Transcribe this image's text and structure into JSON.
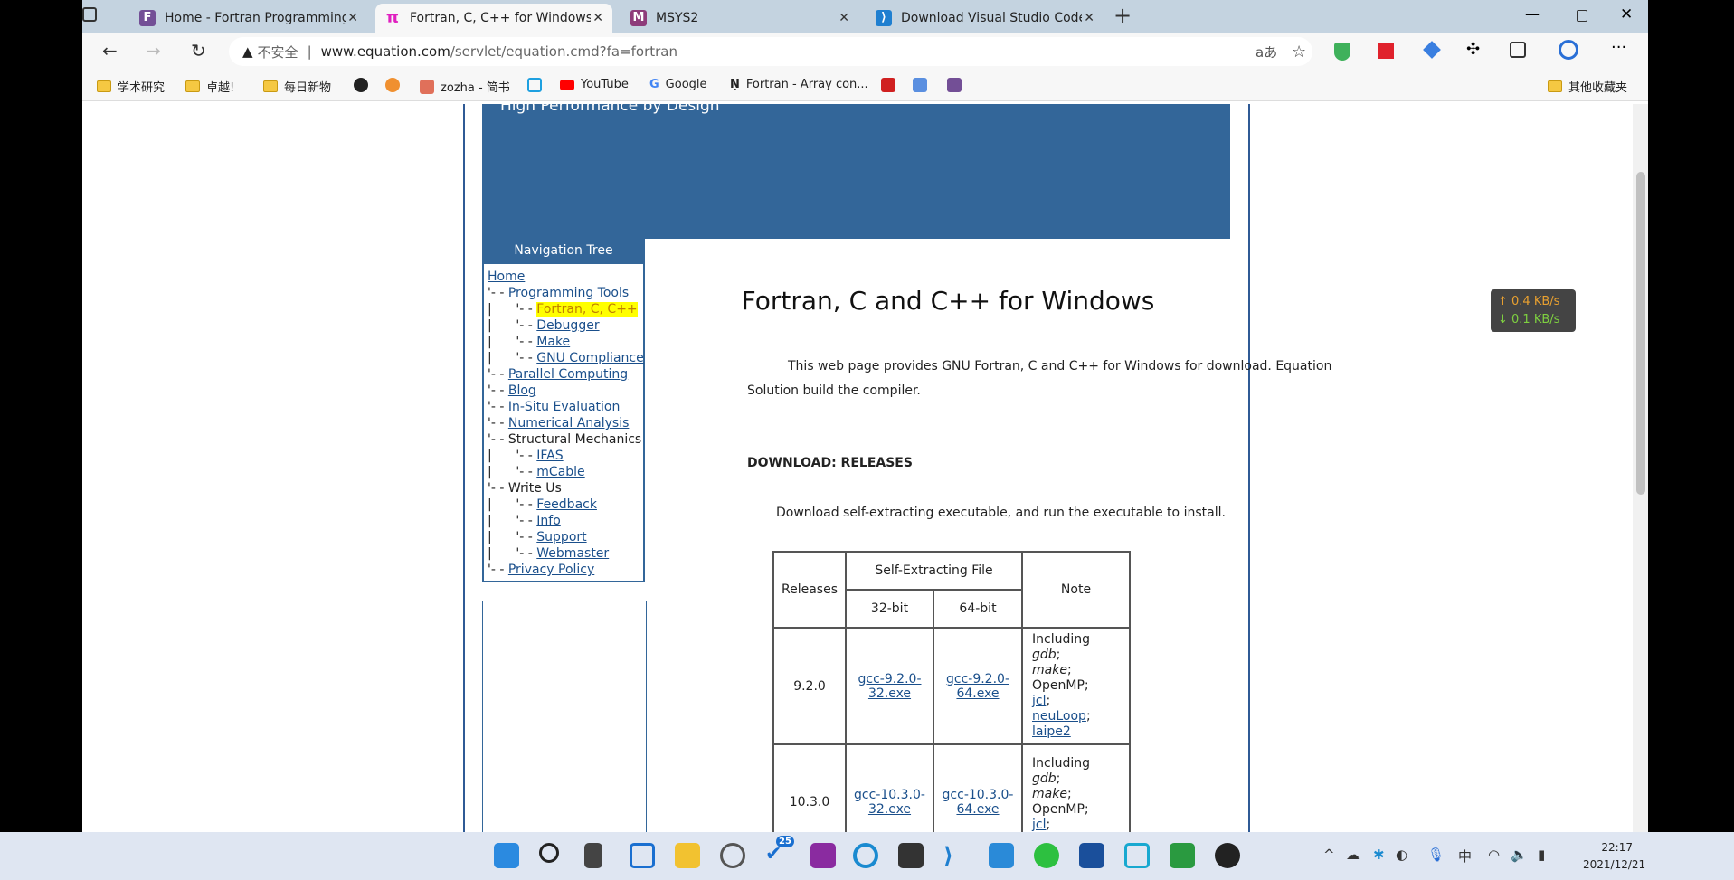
{
  "browser": {
    "tabs": [
      {
        "title": "Home - Fortran Programming La",
        "icon": "fortran-f-icon",
        "color": "#734f96"
      },
      {
        "title": "Fortran, C, C++ for Windows",
        "icon": "pi-icon",
        "color": "#e020c0",
        "active": true
      },
      {
        "title": "MSYS2",
        "icon": "msys2-icon",
        "color": "#8e3b7a"
      },
      {
        "title": "Download Visual Studio Code - M",
        "icon": "vscode-icon",
        "color": "#1f7fd0"
      }
    ],
    "security_label": "不安全",
    "url_host": "www.equation.com",
    "url_path": "/servlet/equation.cmd?fa=fortran",
    "bookmarks": [
      "学术研究",
      "卓越!",
      "每日新物",
      "zozha - 简书",
      "YouTube",
      "Google",
      "Fortran - Array con..."
    ],
    "other_bookmarks": "其他收藏夹"
  },
  "page": {
    "banner_text": "High Performance by Design",
    "nav_title": "Navigation Tree",
    "nav": [
      {
        "prefix": "",
        "label": "Home",
        "link": true
      },
      {
        "prefix": "'- - ",
        "label": "Programming Tools",
        "link": true
      },
      {
        "prefix": "|      '- - ",
        "label": "Fortran, C, C++",
        "current": true
      },
      {
        "prefix": "|      '- - ",
        "label": "Debugger",
        "link": true
      },
      {
        "prefix": "|      '- - ",
        "label": "Make",
        "link": true
      },
      {
        "prefix": "|      '- - ",
        "label": "GNU Compliance",
        "link": true
      },
      {
        "prefix": "'- - ",
        "label": "Parallel Computing",
        "link": true
      },
      {
        "prefix": "'- - ",
        "label": "Blog",
        "link": true
      },
      {
        "prefix": "'- - ",
        "label": "In-Situ Evaluation",
        "link": true
      },
      {
        "prefix": "'- - ",
        "label": "Numerical Analysis",
        "link": true
      },
      {
        "prefix": "'- - ",
        "label": "Structural Mechanics",
        "link": false
      },
      {
        "prefix": "|      '- - ",
        "label": "IFAS",
        "link": true
      },
      {
        "prefix": "|      '- - ",
        "label": "mCable",
        "link": true
      },
      {
        "prefix": "'- - ",
        "label": "Write Us",
        "link": false
      },
      {
        "prefix": "|      '- - ",
        "label": "Feedback",
        "link": true
      },
      {
        "prefix": "|      '- - ",
        "label": "Info",
        "link": true
      },
      {
        "prefix": "|      '- - ",
        "label": "Support",
        "link": true
      },
      {
        "prefix": "|      '- - ",
        "label": "Webmaster",
        "link": true
      },
      {
        "prefix": "'- - ",
        "label": "Privacy Policy",
        "link": true
      }
    ],
    "title": "Fortran, C and C++ for Windows",
    "intro_line1": "This web page provides GNU Fortran, C and C++ for Windows for download. Equation",
    "intro_line2": "Solution build the compiler.",
    "section": "DOWNLOAD: RELEASES",
    "download_text": "Download self-extracting executable, and run the executable to install.",
    "table": {
      "h_releases": "Releases",
      "h_file": "Self-Extracting File",
      "h_note": "Note",
      "h_32": "32-bit",
      "h_64": "64-bit",
      "rows": [
        {
          "release": "9.2.0",
          "f32a": "gcc-9.2.0-",
          "f32b": "32.exe",
          "f64a": "gcc-9.2.0-",
          "f64b": "64.exe"
        },
        {
          "release": "10.3.0",
          "f32a": "gcc-10.3.0-",
          "f32b": "32.exe",
          "f64a": "gcc-10.3.0-",
          "f64b": "64.exe"
        }
      ],
      "note": {
        "including": "Including ",
        "gdb": "gdb",
        "semi": ";",
        "make": "make",
        "openmp": "OpenMP;",
        "jcl": "jcl",
        "neuloop": "neuLoop",
        "laipe2": "laipe2"
      }
    }
  },
  "speed": {
    "up": "↑ 0.4 KB/s",
    "down": "↓ 0.1 KB/s",
    "up_color": "#e8a030",
    "down_color": "#7ed040"
  },
  "taskbar": {
    "badge": "25",
    "time": "22:17",
    "date": "2021/12/21",
    "ime": "中"
  }
}
